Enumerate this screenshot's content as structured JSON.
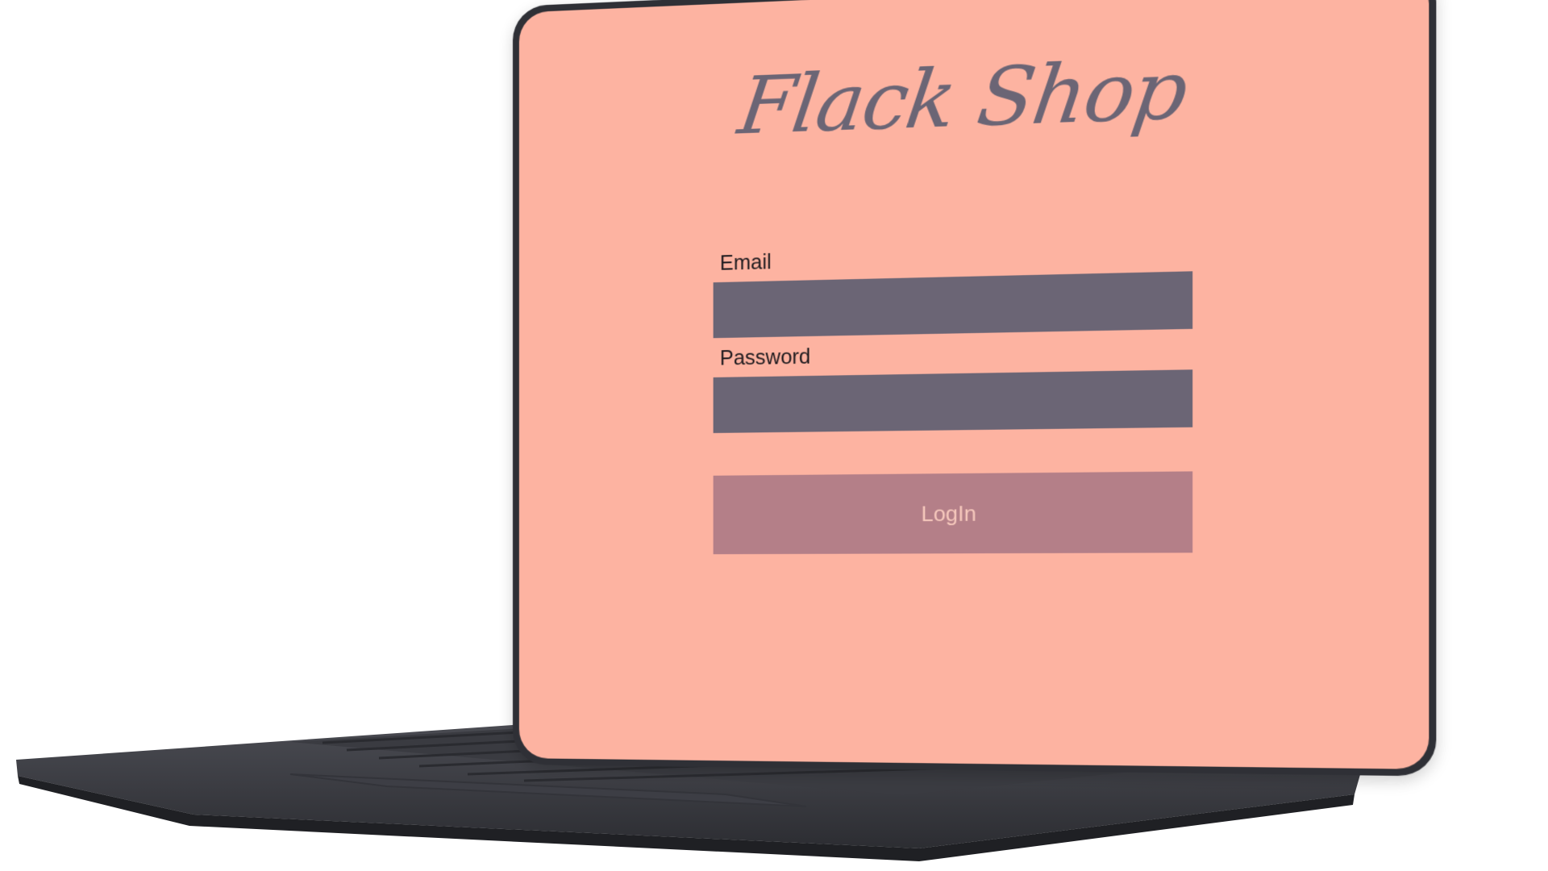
{
  "app": {
    "title": "Flack Shop"
  },
  "login_form": {
    "email_label": "Email",
    "email_value": "",
    "email_placeholder": "",
    "password_label": "Password",
    "password_value": "",
    "password_placeholder": "",
    "login_button_label": "LogIn"
  },
  "colors": {
    "screen_background": "#fdb3a1",
    "input_background": "#6b6575",
    "button_background": "#b47f88",
    "button_text": "#f7c9bd",
    "title_text": "#6b6575",
    "laptop_body": "#2f3036"
  }
}
